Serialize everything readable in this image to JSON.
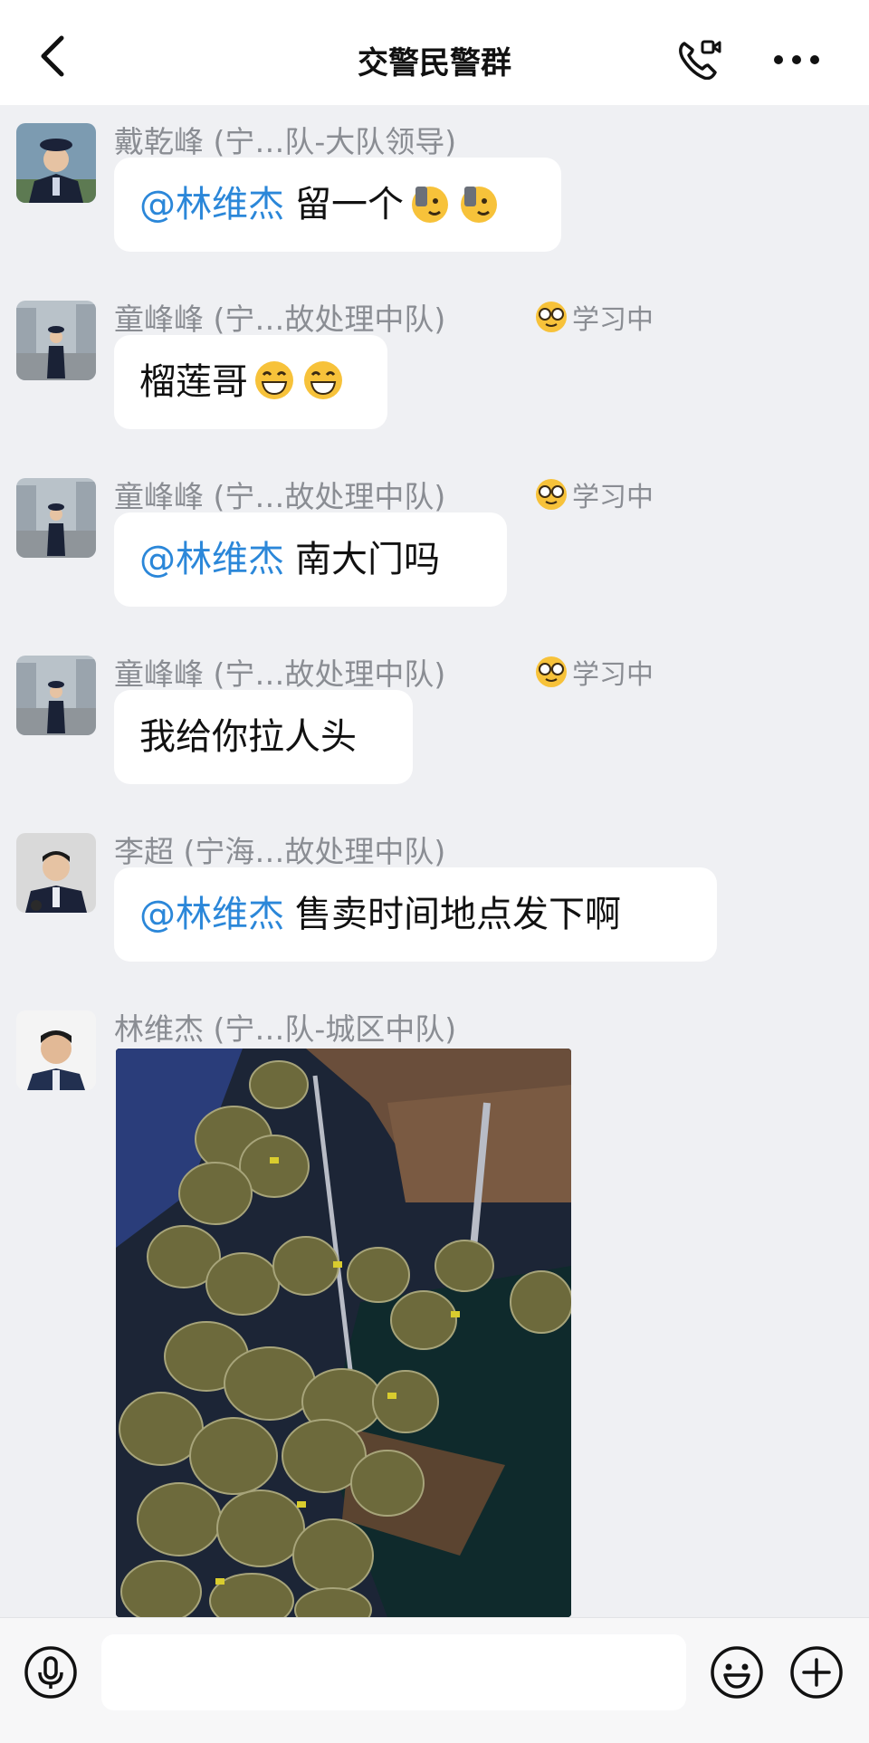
{
  "header": {
    "title": "交警民警群",
    "back_icon": "back-chevron-icon",
    "call_icon": "phone-video-call-icon",
    "more_icon": "more-dots-icon"
  },
  "status_text": "学习中",
  "messages": [
    {
      "sender": "戴乾峰 (宁…队-大队领导)",
      "mention": "@林维杰",
      "text": "留一个",
      "emojis": [
        "salute-wink-emoji",
        "salute-wink-emoji"
      ],
      "has_status": false
    },
    {
      "sender": "童峰峰 (宁…故处理中队)",
      "mention": "",
      "text": "榴莲哥",
      "emojis": [
        "grin-emoji",
        "grin-emoji"
      ],
      "has_status": true
    },
    {
      "sender": "童峰峰 (宁…故处理中队)",
      "mention": "@林维杰",
      "text": "南大门吗",
      "emojis": [],
      "has_status": true
    },
    {
      "sender": "童峰峰 (宁…故处理中队)",
      "mention": "",
      "text": "我给你拉人头",
      "emojis": [],
      "has_status": true
    },
    {
      "sender": "李超 (宁海…故处理中队)",
      "mention": "@林维杰",
      "text": "售卖时间地点发下啊",
      "emojis": [],
      "has_status": false
    },
    {
      "sender": "林维杰 (宁…队-城区中队)",
      "mention": "",
      "text": "",
      "emojis": [],
      "has_status": false,
      "image": "durian-photo"
    }
  ],
  "input_bar": {
    "placeholder": "",
    "voice_icon": "microphone-icon",
    "emoji_icon": "smiley-icon",
    "plus_icon": "plus-icon"
  },
  "colors": {
    "mention": "#2b87d9",
    "background": "#eff0f3",
    "bubble": "#ffffff"
  }
}
